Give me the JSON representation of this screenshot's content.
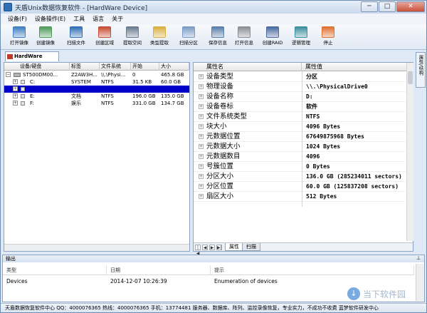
{
  "window": {
    "title": "天盾Unix数据恢复软件 - [HardWare Device]",
    "minimize": "─",
    "maximize": "□",
    "close": "✕"
  },
  "menubar": {
    "items": [
      "设备(F)",
      "设备操作(E)",
      "工具",
      "语言",
      "关于"
    ]
  },
  "toolbar": {
    "buttons": [
      {
        "label": "打开镜像",
        "icon": "open-image-icon",
        "color": "#3d7fc0"
      },
      {
        "label": "创建镜像",
        "icon": "create-image-icon",
        "color": "#4f9a5a"
      },
      {
        "label": "扫描文件",
        "icon": "scan-files-icon",
        "color": "#2f6fb5"
      },
      {
        "label": "创建区域",
        "icon": "create-region-icon",
        "color": "#c84a35"
      },
      {
        "label": "提取空间",
        "icon": "extract-space-icon",
        "color": "#6b7b8f"
      },
      {
        "label": "类型提取",
        "icon": "type-extract-icon",
        "color": "#d8b040"
      },
      {
        "label": "扫描分区",
        "icon": "scan-partition-icon",
        "color": "#7a9cc4"
      },
      {
        "label": "保存信息",
        "icon": "save-info-icon",
        "color": "#5a7fa8"
      },
      {
        "label": "打开信息",
        "icon": "open-info-icon",
        "color": "#8a8f96"
      },
      {
        "label": "创建RAID",
        "icon": "create-raid-icon",
        "color": "#4a6aa0"
      },
      {
        "label": "逻辑管理",
        "icon": "logic-manage-icon",
        "color": "#3b8f9e"
      },
      {
        "label": "停止",
        "icon": "stop-icon",
        "color": "#e07030"
      }
    ]
  },
  "doc_tab": {
    "label": "HardWare Device",
    "close": "×"
  },
  "side_tab": {
    "label": "属性/结构"
  },
  "device_list": {
    "columns": [
      "设备/硬盘",
      "标签",
      "文件系统",
      "开始",
      "大小"
    ],
    "rows": [
      {
        "expander": "⊟",
        "name": "ST500DM00...",
        "label": "Z2AW3H...",
        "fs": "\\\\.\\Physi...",
        "start": "0",
        "size": "465.8 GB",
        "kind": "drive"
      },
      {
        "expander": "⊞",
        "name": "C:",
        "label": "SYSTEM",
        "fs": "NTFS",
        "start": "31.5 KB",
        "size": "60.0 GB",
        "kind": "partition"
      },
      {
        "expander": "⊞",
        "name": "",
        "label": "",
        "fs": "",
        "start": "",
        "size": "",
        "kind": "partition-selected"
      },
      {
        "expander": "⊞",
        "name": "E:",
        "label": "文档",
        "fs": "NTFS",
        "start": "196.0 GB",
        "size": "135.0 GB",
        "kind": "partition"
      },
      {
        "expander": "⊞",
        "name": "F:",
        "label": "娱乐",
        "fs": "NTFS",
        "start": "331.0 GB",
        "size": "134.7 GB",
        "kind": "partition"
      }
    ]
  },
  "properties": {
    "columns": [
      "属性名",
      "属性值"
    ],
    "rows": [
      {
        "name": "设备类型",
        "value": "分区"
      },
      {
        "name": "物理设备",
        "value": "\\\\.\\PhysicalDrive0"
      },
      {
        "name": "设备名称",
        "value": "D:"
      },
      {
        "name": "设备卷标",
        "value": "软件"
      },
      {
        "name": "文件系统类型",
        "value": "NTFS"
      },
      {
        "name": "块大小",
        "value": "4096 Bytes"
      },
      {
        "name": "元数据位置",
        "value": "67649875968 Bytes"
      },
      {
        "name": "元数据大小",
        "value": "1024 Bytes"
      },
      {
        "name": "元数据数目",
        "value": "4096"
      },
      {
        "name": "号簇位置",
        "value": "0 Bytes"
      },
      {
        "name": "分区大小",
        "value": "136.0 GB (285234011 sectors)"
      },
      {
        "name": "分区位置",
        "value": "60.0 GB (125837208 sectors)"
      },
      {
        "name": "扇区大小",
        "value": "512 Bytes"
      }
    ],
    "tabs": [
      "属性",
      "扫描"
    ]
  },
  "output": {
    "title": "输出",
    "columns": [
      "类型",
      "日期",
      "提示"
    ],
    "rows": [
      {
        "type": "Devices",
        "date": "2014-12-07 10:26:39",
        "message": "Enumeration of devices"
      }
    ]
  },
  "statusbar": {
    "text": "天盾数据恢复软件中心 QQ：4000076365 热线：4000076365 手机：13774481   服务器、数据库、阵列、监控录像恢复，专业实力，不成功不收费   蓝梦软件研发中心"
  },
  "watermark": {
    "glyph": "↓",
    "text": "当下软件园"
  },
  "colors": {
    "selection": "#0000c8",
    "accent": "#2f6fb5",
    "frame": "#dfe9f5"
  }
}
